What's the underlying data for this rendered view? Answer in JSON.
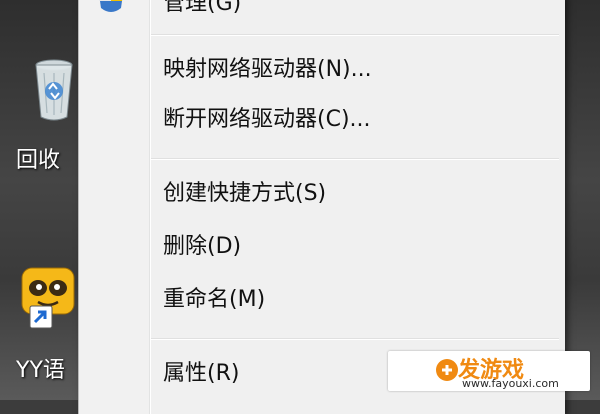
{
  "desktop": {
    "icons": [
      {
        "label": "回收"
      },
      {
        "label": "YY语"
      }
    ]
  },
  "context_menu": {
    "top_item": "管理(G)",
    "items": [
      {
        "label": "映射网络驱动器(N)..."
      },
      {
        "label": "断开网络驱动器(C)..."
      },
      {
        "label": "创建快捷方式(S)"
      },
      {
        "label": "删除(D)"
      },
      {
        "label": "重命名(M)"
      },
      {
        "label": "属性(R)"
      }
    ]
  },
  "watermark": {
    "main": "发游戏",
    "url": "www.fayouxi.com"
  },
  "colors": {
    "menu_background": "#f0f0f0",
    "watermark_accent": "#f08a12"
  }
}
